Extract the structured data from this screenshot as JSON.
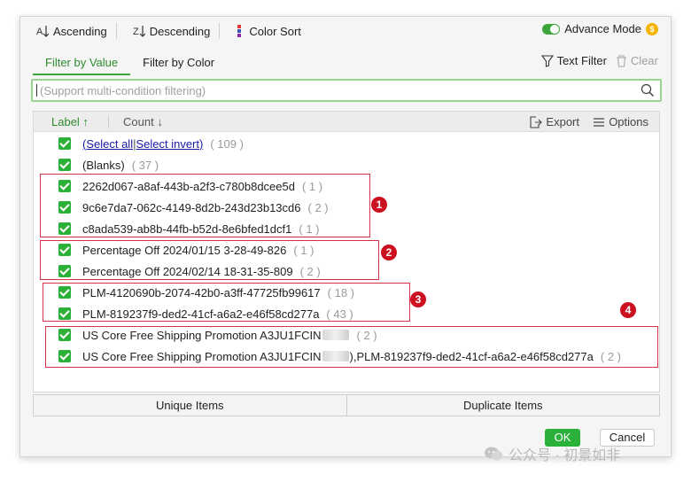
{
  "toolbar": {
    "ascending": "Ascending",
    "descending": "Descending",
    "color_sort": "Color Sort",
    "advance_mode": "Advance Mode"
  },
  "tabs": {
    "by_value": "Filter by Value",
    "by_color": "Filter by Color",
    "text_filter": "Text Filter",
    "clear": "Clear"
  },
  "search": {
    "placeholder": "(Support multi-condition filtering)",
    "value": ""
  },
  "list": {
    "label_header": "Label",
    "count_header": "Count",
    "export": "Export",
    "options": "Options",
    "select_all": "(Select all",
    "select_invert": "Select invert)",
    "select_all_count": "( 109 )",
    "items": [
      {
        "label": "(Blanks)",
        "count": "( 37 )"
      },
      {
        "label": "2262d067-a8af-443b-a2f3-c780b8dcee5d",
        "count": "( 1 )"
      },
      {
        "label": "9c6e7da7-062c-4149-8d2b-243d23b13cd6",
        "count": "( 2 )"
      },
      {
        "label": "c8ada539-ab8b-44fb-b52d-8e6bfed1dcf1",
        "count": "( 1 )"
      },
      {
        "label": "Percentage Off 2024/01/15 3-28-49-826",
        "count": "( 1 )"
      },
      {
        "label": "Percentage Off 2024/02/14 18-31-35-809",
        "count": "( 2 )"
      },
      {
        "label": "PLM-4120690b-2074-42b0-a3ff-47725fb99617",
        "count": "( 18 )"
      },
      {
        "label": "PLM-819237f9-ded2-41cf-a6a2-e46f58cd277a",
        "count": "( 43 )"
      },
      {
        "label_a": "US Core Free Shipping Promotion A3JU1FCIN",
        "label_b": "",
        "count": "( 2 )"
      },
      {
        "label_a": "US Core Free Shipping Promotion A3JU1FCIN",
        "label_b": "),PLM-819237f9-ded2-41cf-a6a2-e46f58cd277a",
        "count": "( 2 )"
      }
    ]
  },
  "markers": [
    "1",
    "2",
    "3",
    "4"
  ],
  "buttons": {
    "unique": "Unique Items",
    "duplicate": "Duplicate Items",
    "ok": "OK",
    "cancel": "Cancel"
  },
  "watermark": "公众号 · 初景如非",
  "colors": {
    "accent": "#2bb03a",
    "annotation": "#cc1020",
    "link": "#1a1aa6"
  }
}
